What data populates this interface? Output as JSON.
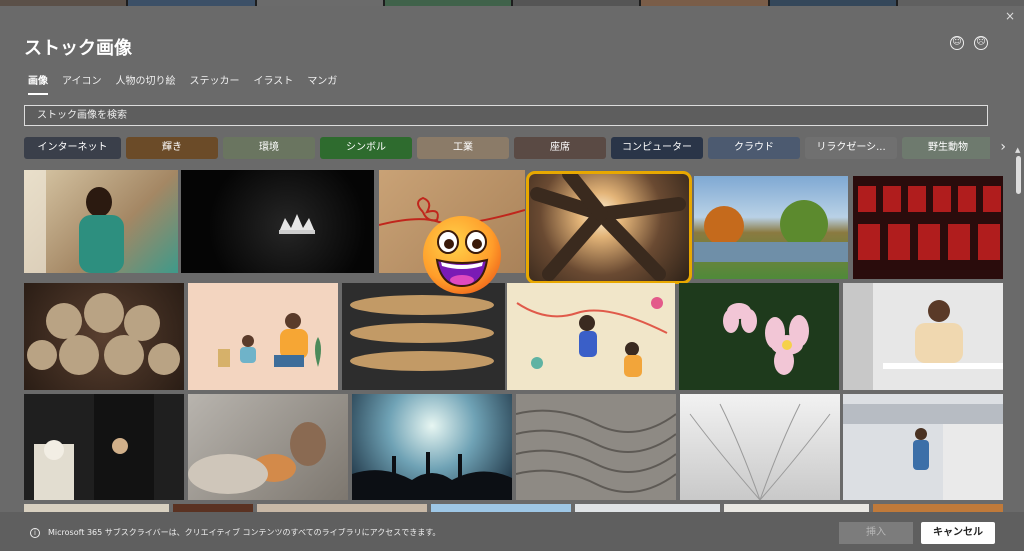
{
  "dialog": {
    "title": "ストック画像",
    "close_icon": "×"
  },
  "tabs": [
    {
      "label": "画像",
      "active": true
    },
    {
      "label": "アイコン",
      "active": false
    },
    {
      "label": "人物の切り絵",
      "active": false
    },
    {
      "label": "ステッカー",
      "active": false
    },
    {
      "label": "イラスト",
      "active": false
    },
    {
      "label": "マンガ",
      "active": false
    }
  ],
  "search": {
    "placeholder": "ストック画像を検索"
  },
  "chips": [
    {
      "label": "インターネット",
      "color": "#3a3f4a"
    },
    {
      "label": "輝き",
      "color": "#6b4b28"
    },
    {
      "label": "環境",
      "color": "#6a7560"
    },
    {
      "label": "シンボル",
      "color": "#2e6b2e"
    },
    {
      "label": "工業",
      "color": "#8b7b68"
    },
    {
      "label": "座席",
      "color": "#5a4a44"
    },
    {
      "label": "コンピューター",
      "color": "#2a3548"
    },
    {
      "label": "クラウド",
      "color": "#4c5a70"
    },
    {
      "label": "リラクゼーシ...",
      "color": "#707070"
    },
    {
      "label": "野生動物",
      "color": "#6e7a6e"
    }
  ],
  "footer": {
    "info": "Microsoft 365 サブスクライバーは、クリエイティブ コンテンツのすべてのライブラリにアクセスできます。",
    "insert_label": "挿入",
    "cancel_label": "キャンセル"
  },
  "colors": {
    "selection": "#e8a800",
    "dialog_bg": "#6a6a6a"
  }
}
